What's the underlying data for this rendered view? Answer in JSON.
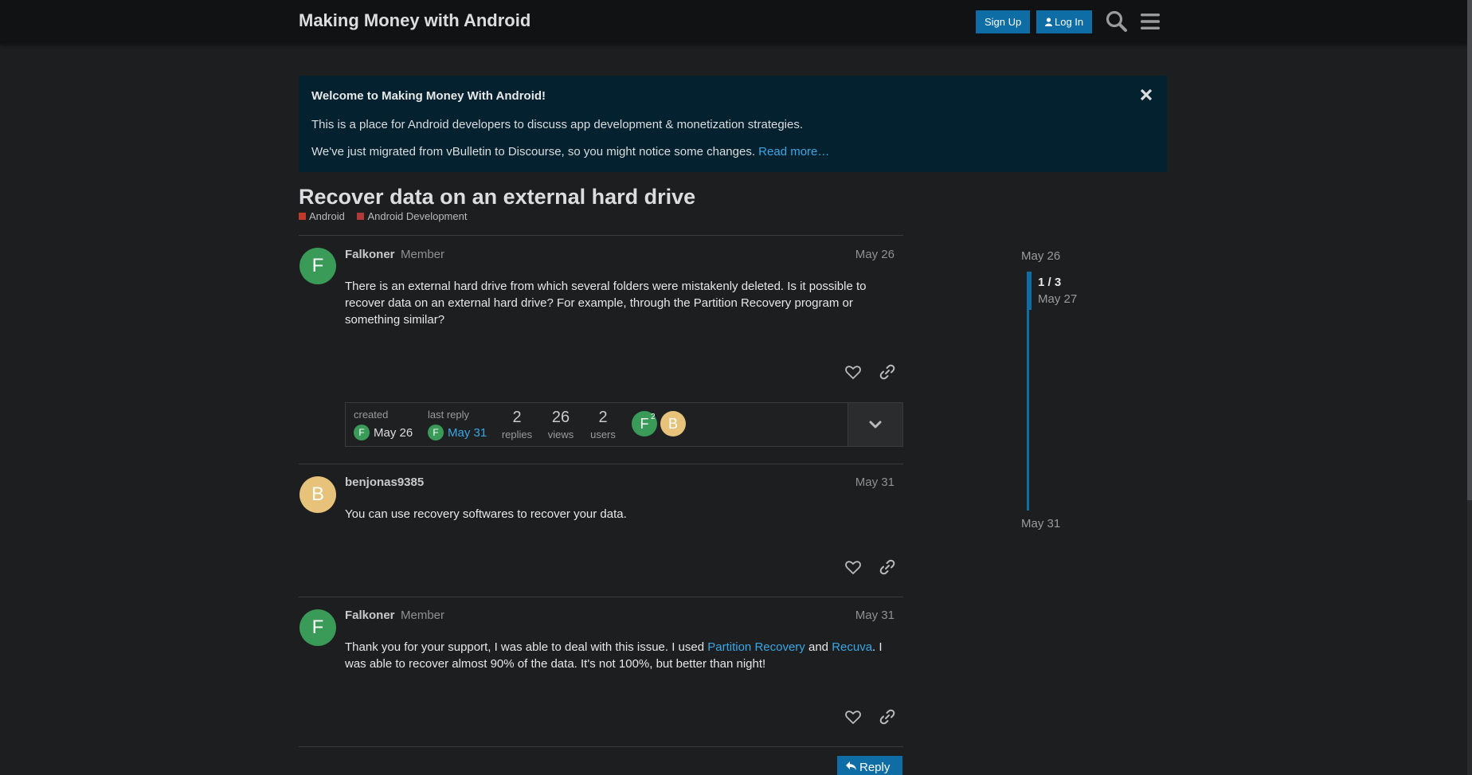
{
  "header": {
    "title": "Making Money with Android",
    "signup_label": "Sign Up",
    "login_label": "Log In"
  },
  "banner": {
    "title": "Welcome to Making Money With Android!",
    "line1": "This is a place for Android developers to discuss app development & monetization strategies.",
    "line2": "We've just migrated from vBulletin to Discourse, so you might notice some changes.",
    "read_more": "Read more…"
  },
  "topic": {
    "title": "Recover data on an external hard drive",
    "categories": [
      {
        "name": "Android",
        "color": "#c0392b"
      },
      {
        "name": "Android Development",
        "color": "#b03a3a"
      }
    ]
  },
  "posts": [
    {
      "avatar_letter": "F",
      "username": "Falkoner",
      "role": "Member",
      "date": "May 26",
      "body": "There is an external hard drive from which several folders were mistakenly deleted. Is it possible to recover data on an external hard drive? For example, through the Partition Recovery program or something similar?"
    },
    {
      "avatar_letter": "B",
      "username": "benjonas9385",
      "role": "",
      "date": "May 31",
      "body": "You can use recovery softwares to recover your data."
    },
    {
      "avatar_letter": "F",
      "username": "Falkoner",
      "role": "Member",
      "date": "May 31",
      "body_pre": "Thank you for your support, I was able to deal with this issue. I used ",
      "link1": "Partition Recovery",
      "body_mid": " and ",
      "link2": "Recuva",
      "body_post": ". I was able to recover almost 90% of the data. It's not 100%, but better than night!"
    }
  ],
  "summary": {
    "created_label": "created",
    "created_date": "May 26",
    "created_avatar": "F",
    "last_reply_label": "last reply",
    "last_reply_date": "May 31",
    "last_reply_avatar": "F",
    "replies_count": "2",
    "replies_label": "replies",
    "views_count": "26",
    "views_label": "views",
    "users_count": "2",
    "users_label": "users",
    "participants": [
      {
        "letter": "F",
        "count": "2"
      },
      {
        "letter": "B",
        "count": ""
      }
    ]
  },
  "reply_label": "Reply",
  "timeline": {
    "start_date": "May 26",
    "position": "1 / 3",
    "position_date": "May 27",
    "end_date": "May 31"
  }
}
